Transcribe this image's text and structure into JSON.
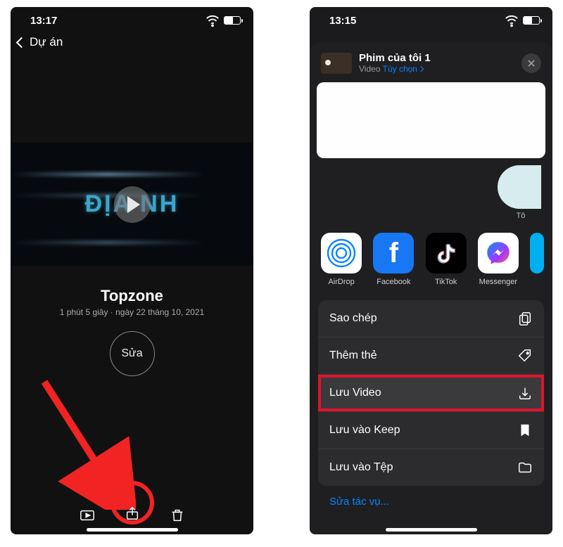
{
  "left": {
    "status_time": "13:17",
    "back_label": "Dự án",
    "video_text": "ĐỊA    NH",
    "title": "Topzone",
    "subtitle": "1 phút 5 giây · ngày 22 tháng 10, 2021",
    "edit_label": "Sửa"
  },
  "right": {
    "status_time": "13:15",
    "sheet_title": "Phim của tôi 1",
    "sheet_sub_type": "Video",
    "sheet_sub_link": "Tùy chọn",
    "contact_partial_label": "Tô",
    "apps": {
      "airdrop": "AirDrop",
      "facebook": "Facebook",
      "tiktok": "TikTok",
      "messenger": "Messenger"
    },
    "actions": {
      "copy": "Sao chép",
      "add_tag": "Thêm thẻ",
      "save_video": "Lưu Video",
      "save_keep": "Lưu vào Keep",
      "save_files": "Lưu vào Tệp"
    },
    "edit_actions": "Sửa tác vụ..."
  }
}
